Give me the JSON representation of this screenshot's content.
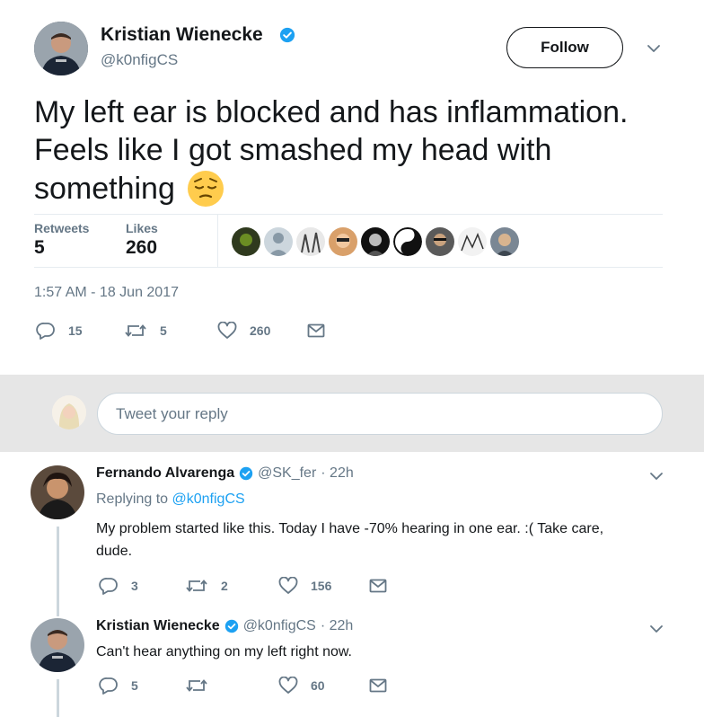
{
  "tweet": {
    "author_name": "Kristian Wienecke",
    "author_handle": "@k0nfigCS",
    "follow_label": "Follow",
    "text_line1": "My left ear is blocked and has inflammation.",
    "text_line2": "Feels like I got smashed my head with",
    "text_line3": "something",
    "retweets_label": "Retweets",
    "retweets_count": "5",
    "likes_label": "Likes",
    "likes_count": "260",
    "timestamp": "1:57 AM - 18 Jun 2017",
    "actions": {
      "reply": "15",
      "retweet": "5",
      "like": "260"
    },
    "emoji": "pensive-face"
  },
  "reply_box": {
    "placeholder": "Tweet your reply"
  },
  "replies": [
    {
      "name": "Fernando Alvarenga",
      "handle": "@SK_fer",
      "time": "· 22h",
      "replying_prefix": "Replying to",
      "replying_to": "@k0nfigCS",
      "text_line1": "My problem started like this. Today I have -70% hearing in one ear. :(  Take care,",
      "text_line2": "dude.",
      "actions": {
        "reply": "3",
        "retweet": "2",
        "like": "156"
      }
    },
    {
      "name": "Kristian Wienecke",
      "handle": "@k0nfigCS",
      "time": "· 22h",
      "text_line1": "Can't hear anything on my left right now.",
      "actions": {
        "reply": "5",
        "retweet": "",
        "like": "60"
      }
    }
  ],
  "colors": {
    "accent": "#1da1f2",
    "muted": "#657786",
    "divider": "#e6ecf0",
    "reply_band": "#e6e6e6"
  }
}
